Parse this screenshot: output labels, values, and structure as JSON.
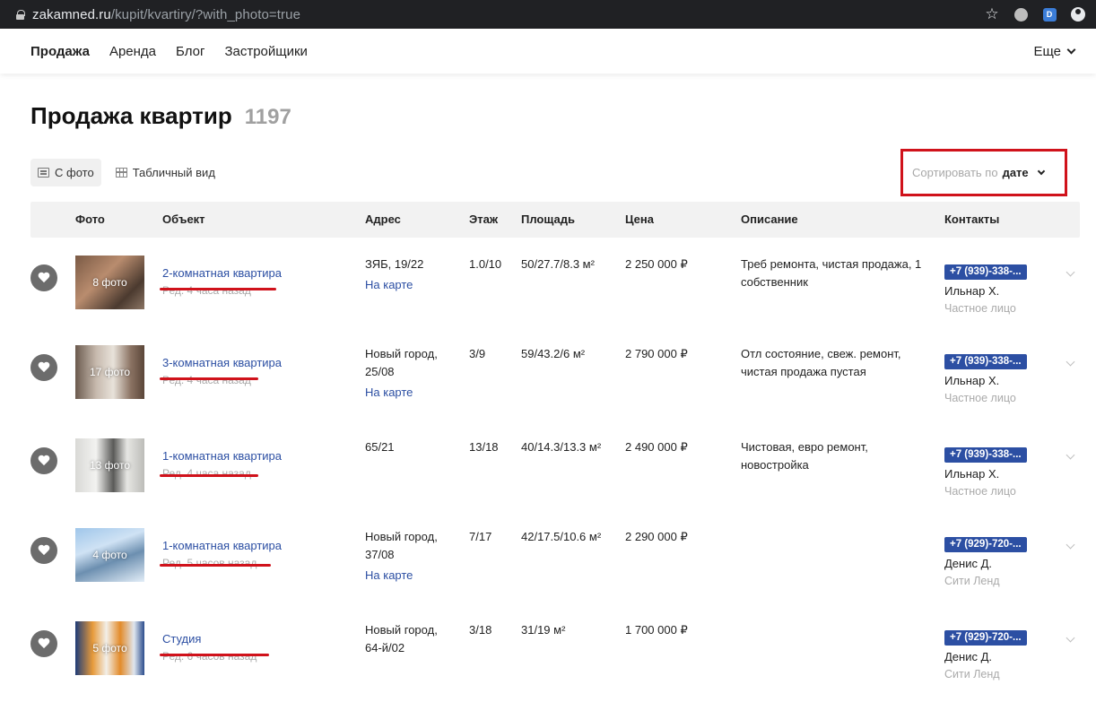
{
  "browser": {
    "url_domain": "zakamned.ru",
    "url_path": "/kupit/kvartiry/?with_photo=true"
  },
  "nav": {
    "items": [
      "Продажа",
      "Аренда",
      "Блог",
      "Застройщики"
    ],
    "more": "Еще"
  },
  "header": {
    "title": "Продажа квартир",
    "count": "1197"
  },
  "view": {
    "photo": "С фото",
    "table": "Табличный вид"
  },
  "sort": {
    "label": "Сортировать по",
    "value": "дате"
  },
  "columns": [
    "Фото",
    "Объект",
    "Адрес",
    "Этаж",
    "Площадь",
    "Цена",
    "Описание",
    "Контакты"
  ],
  "listings": [
    {
      "photos": "8 фото",
      "title": "2-комнатная квартира",
      "time": "Ред. 4 часа назад",
      "address": "ЗЯБ, 19/22",
      "address2": "",
      "map": "На карте",
      "floor": "1.0/10",
      "area": "50/27.7/8.3 м²",
      "price": "2 250 000 ₽",
      "desc1": "Треб ремонта, чистая продажа, 1",
      "desc2": "собственник",
      "phone": "+7 (939)-338-...",
      "name": "Ильнар Х.",
      "type": "Частное лицо"
    },
    {
      "photos": "17 фото",
      "title": "3-комнатная квартира",
      "time": "Ред. 4 часа назад",
      "address": "Новый город,",
      "address2": "25/08",
      "map": "На карте",
      "floor": "3/9",
      "area": "59/43.2/6 м²",
      "price": "2 790 000 ₽",
      "desc1": "Отл состояние, свеж. ремонт,",
      "desc2": "чистая продажа пустая",
      "phone": "+7 (939)-338-...",
      "name": "Ильнар Х.",
      "type": "Частное лицо"
    },
    {
      "photos": "13 фото",
      "title": "1-комнатная квартира",
      "time": "Ред. 4 часа назад",
      "address": "65/21",
      "address2": "",
      "map": "",
      "floor": "13/18",
      "area": "40/14.3/13.3 м²",
      "price": "2 490 000 ₽",
      "desc1": "Чистовая, евро ремонт,",
      "desc2": "новостройка",
      "phone": "+7 (939)-338-...",
      "name": "Ильнар Х.",
      "type": "Частное лицо"
    },
    {
      "photos": "4 фото",
      "title": "1-комнатная квартира",
      "time": "Ред. 5 часов назад",
      "address": "Новый город,",
      "address2": "37/08",
      "map": "На карте",
      "floor": "7/17",
      "area": "42/17.5/10.6 м²",
      "price": "2 290 000 ₽",
      "desc1": "",
      "desc2": "",
      "phone": "+7 (929)-720-...",
      "name": "Денис Д.",
      "type": "Сити Ленд"
    },
    {
      "photos": "5 фото",
      "title": "Студия",
      "time": "Ред. 6 часов назад",
      "address": "Новый город,",
      "address2": "64-й/02",
      "map": "",
      "floor": "3/18",
      "area": "31/19 м²",
      "price": "1 700 000 ₽",
      "desc1": "",
      "desc2": "",
      "phone": "+7 (929)-720-...",
      "name": "Денис Д.",
      "type": "Сити Ленд"
    }
  ]
}
